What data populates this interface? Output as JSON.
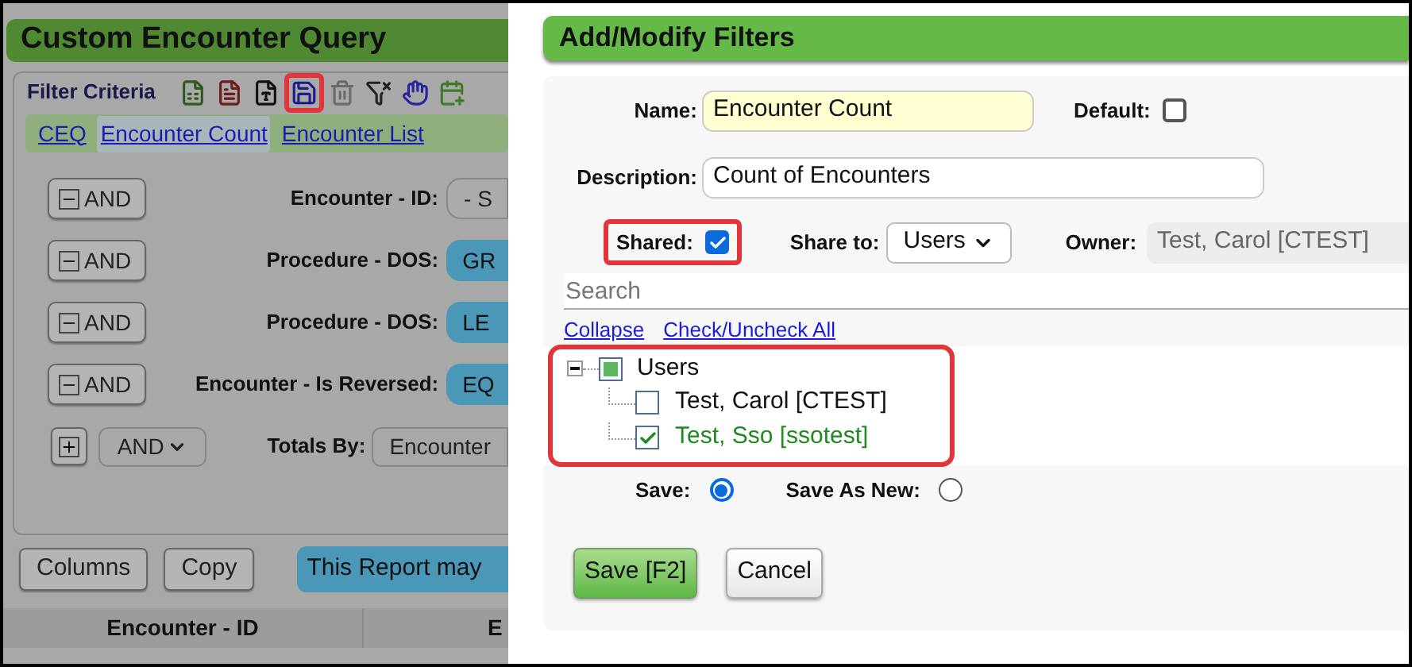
{
  "background_page": {
    "title": "Custom Encounter Query",
    "filter_criteria": {
      "legend": "Filter Criteria",
      "toolbar": [
        {
          "kind": "excel",
          "highlighted": false
        },
        {
          "kind": "pdf",
          "highlighted": false
        },
        {
          "kind": "word",
          "highlighted": false
        },
        {
          "kind": "save",
          "highlighted": true
        },
        {
          "kind": "delete",
          "highlighted": false
        },
        {
          "kind": "clear-filter",
          "highlighted": false
        },
        {
          "kind": "hand",
          "highlighted": false
        },
        {
          "kind": "add",
          "highlighted": false
        }
      ],
      "tabs": [
        {
          "label": "CEQ",
          "selected": false
        },
        {
          "label": "Encounter Count",
          "selected": true
        },
        {
          "label": "Encounter List",
          "selected": false
        }
      ],
      "filters": [
        {
          "operator": "AND",
          "label": "Encounter - ID:",
          "value": "- S",
          "kind": "select"
        },
        {
          "operator": "AND",
          "label": "Procedure - DOS:",
          "value": "GR",
          "kind": "pill"
        },
        {
          "operator": "AND",
          "label": "Procedure - DOS:",
          "value": "LE",
          "kind": "pill"
        },
        {
          "operator": "AND",
          "label": "Encounter - Is Reversed:",
          "value": "EQ",
          "kind": "pill"
        }
      ],
      "add_row": {
        "operator": "AND",
        "label": "Totals By:",
        "value": "Encounter"
      }
    },
    "buttons": [
      "Columns",
      "Copy"
    ],
    "notice": "This Report may",
    "table": {
      "columns": [
        "Encounter - ID",
        "E"
      ]
    }
  },
  "dialog": {
    "title": "Add/Modify Filters",
    "name": {
      "label": "Name:",
      "value": "Encounter Count"
    },
    "default": {
      "label": "Default:",
      "checked": false
    },
    "description": {
      "label": "Description:",
      "value": "Count of Encounters"
    },
    "shared": {
      "label": "Shared:",
      "checked": true,
      "highlighted": true
    },
    "share_to": {
      "label": "Share to:",
      "value": "Users"
    },
    "owner": {
      "label": "Owner:",
      "value": "Test, Carol [CTEST]"
    },
    "search": {
      "placeholder": "Search"
    },
    "links": [
      "Collapse",
      "Check/Uncheck All"
    ],
    "tree": {
      "highlighted": true,
      "nodes": [
        {
          "label": "Users",
          "expanded": true,
          "checked": false,
          "partial": true,
          "children": [
            {
              "label": "Test, Carol [CTEST]",
              "checked": false
            },
            {
              "label": "Test, Sso [ssotest]",
              "checked": true
            }
          ]
        }
      ]
    },
    "save_mode": [
      {
        "label": "Save:",
        "selected": true
      },
      {
        "label": "Save As New:",
        "selected": false
      }
    ],
    "buttons": [
      {
        "label": "Save [F2]",
        "kind": "primary"
      },
      {
        "label": "Cancel",
        "kind": "secondary"
      }
    ]
  }
}
